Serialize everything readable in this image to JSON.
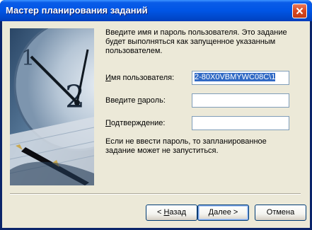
{
  "window": {
    "title": "Мастер планирования заданий"
  },
  "intro_text": "Введите имя и пароль пользователя. Это задание будет выполняться как запущенное указанным пользователем.",
  "form": {
    "username_label_hotkey": "И",
    "username_label_rest": "мя пользователя:",
    "username_value": "2-80X0VBMYWC08C\\1",
    "password_label_prefix": "Введите ",
    "password_label_hotkey": "п",
    "password_label_rest": "ароль:",
    "password_value": "",
    "confirm_label_hotkey": "П",
    "confirm_label_rest": "одтверждение:",
    "confirm_value": ""
  },
  "note_text": "Если не ввести пароль, то запланированное задание может не запуститься.",
  "buttons": {
    "back_prefix": "< ",
    "back_hotkey": "Н",
    "back_rest": "азад",
    "next_hotkey": "Д",
    "next_rest": "алее >",
    "cancel": "Отмена"
  },
  "icons": {
    "close": "close-icon",
    "illustration": "clock-and-pen-illustration"
  },
  "colors": {
    "titlebar": "#0055e5",
    "dialog_bg": "#ece9d8",
    "selection": "#316ac5",
    "close_button": "#d8461e"
  }
}
